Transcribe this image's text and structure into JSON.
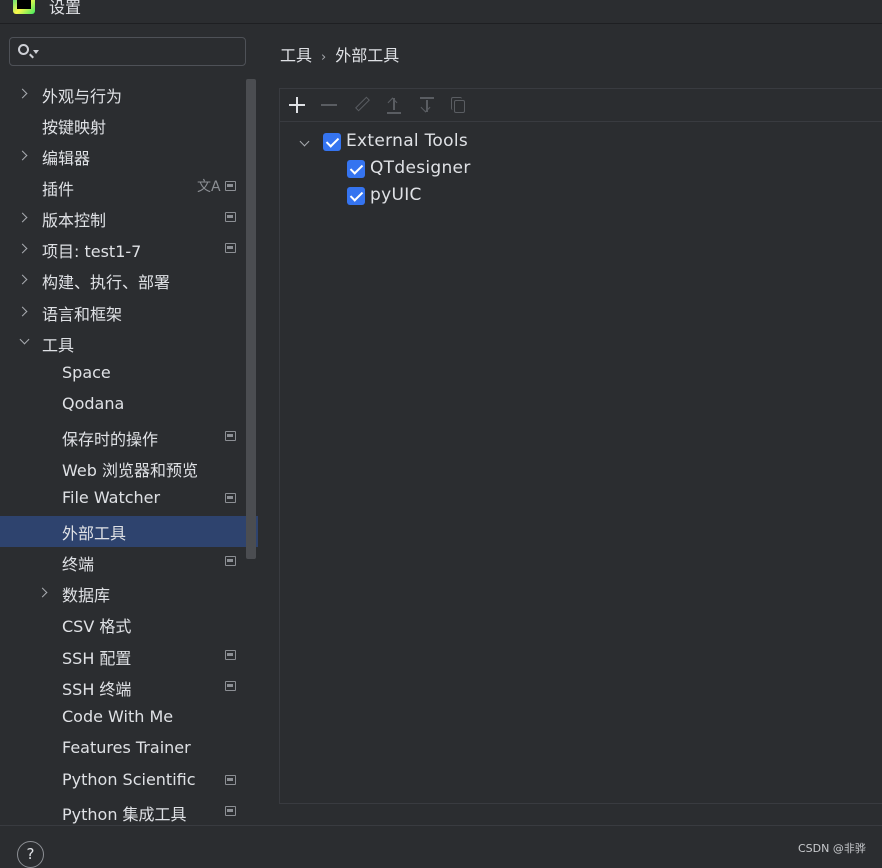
{
  "window": {
    "title": "设置"
  },
  "search": {
    "placeholder": ""
  },
  "sidebar": {
    "items": [
      {
        "label": "外观与行为"
      },
      {
        "label": "按键映射"
      },
      {
        "label": "编辑器"
      },
      {
        "label": "插件",
        "translate_icon": "文A"
      },
      {
        "label": "版本控制"
      },
      {
        "label": "项目: test1-7"
      },
      {
        "label": "构建、执行、部署"
      },
      {
        "label": "语言和框架"
      },
      {
        "label": "工具"
      },
      {
        "label": "Space"
      },
      {
        "label": "Qodana"
      },
      {
        "label": "保存时的操作"
      },
      {
        "label": "Web 浏览器和预览"
      },
      {
        "label": "File Watcher"
      },
      {
        "label": "外部工具",
        "selected": true
      },
      {
        "label": "终端"
      },
      {
        "label": "数据库"
      },
      {
        "label": "CSV 格式"
      },
      {
        "label": "SSH 配置"
      },
      {
        "label": "SSH 终端"
      },
      {
        "label": "Code With Me"
      },
      {
        "label": "Features Trainer"
      },
      {
        "label": "Python Scientific"
      },
      {
        "label": "Python 集成工具"
      }
    ]
  },
  "breadcrumb": {
    "parent": "工具",
    "separator": "›",
    "current": "外部工具"
  },
  "toolbar": {
    "icons": [
      "add-icon",
      "remove-icon",
      "edit-icon",
      "move-up-icon",
      "move-down-icon",
      "copy-icon"
    ]
  },
  "tools_tree": {
    "group": {
      "label": "External Tools",
      "checked": true,
      "expanded": true
    },
    "items": [
      {
        "label": "QTdesigner",
        "checked": true
      },
      {
        "label": "pyUIC",
        "checked": true
      }
    ]
  },
  "footer": {
    "help": "?",
    "watermark": "CSDN @非骅"
  },
  "colors": {
    "accent": "#3574f0",
    "selection": "#2e436e",
    "background": "#2b2d30"
  }
}
